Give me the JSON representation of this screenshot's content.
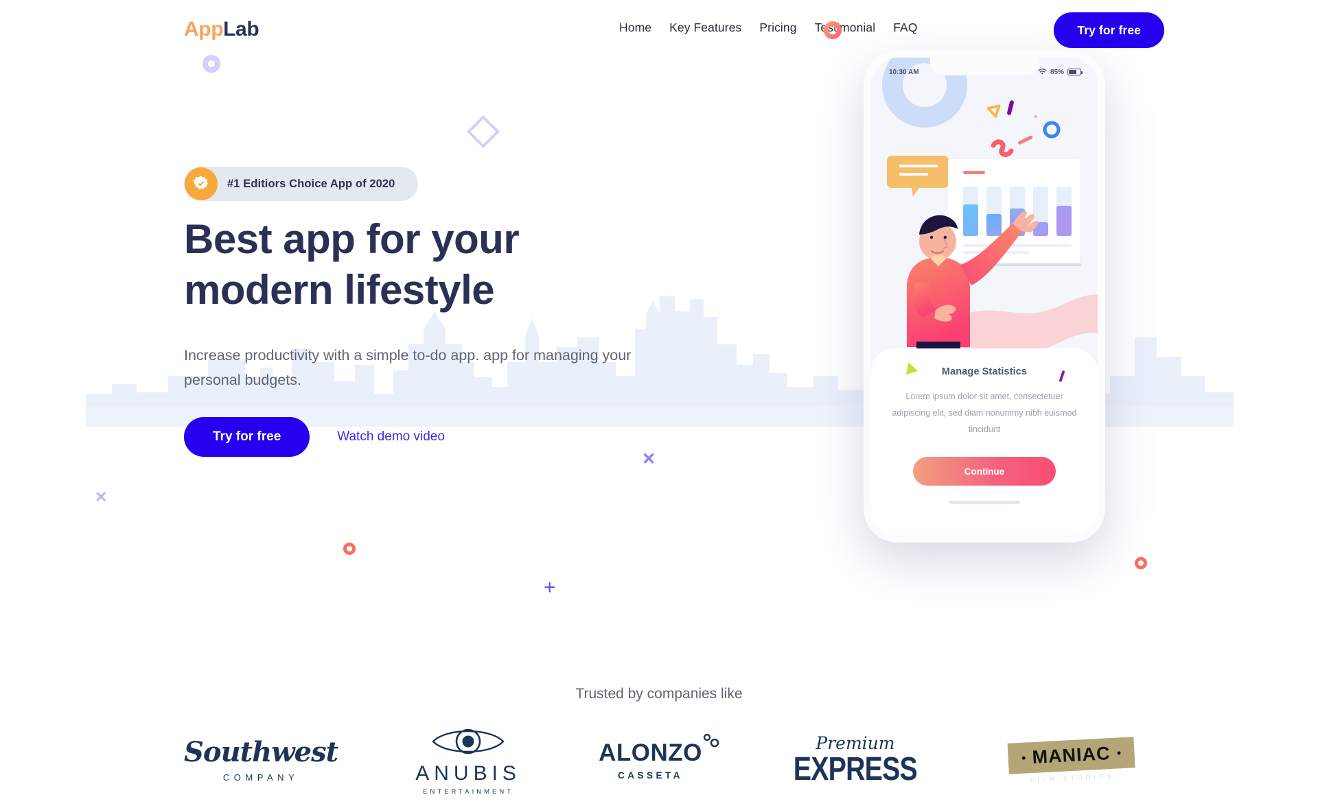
{
  "brand": {
    "name_part1": "App",
    "name_part2": "Lab",
    "color_accent": "#F6A560",
    "color_dark": "#2B3154"
  },
  "nav": {
    "items": [
      {
        "label": "Home"
      },
      {
        "label": "Key Features"
      },
      {
        "label": "Pricing"
      },
      {
        "label": "Testimonial"
      },
      {
        "label": "FAQ"
      }
    ],
    "cta_label": "Try for free",
    "cta_color": "#2400EE"
  },
  "hero": {
    "badge": {
      "text": "#1 Editiors Choice App of 2020",
      "icon": "verified-badge-icon",
      "icon_color": "#F9A83E",
      "bg": "#E4E9EF"
    },
    "headline_line1": "Best app for your",
    "headline_line2": "modern lifestyle",
    "subhead": "Increase productivity with a simple to-do app. app for managing your personal budgets.",
    "primary_cta": "Try for free",
    "secondary_cta": "Watch demo video",
    "secondary_cta_color": "#3A2BE8"
  },
  "decorations": [
    {
      "name": "ring-purple",
      "color": "#D5CFFA"
    },
    {
      "name": "diamond-outline",
      "color": "#D4CEFB"
    },
    {
      "name": "cross-mark",
      "color": "#8A7BF2"
    },
    {
      "name": "cross-mark",
      "color": "#B9B2F5"
    },
    {
      "name": "plus-sign",
      "color": "#4D5BE8"
    },
    {
      "name": "ring-coral",
      "color": "#FA6E62"
    },
    {
      "name": "ring-coral",
      "color": "#FA6E62"
    },
    {
      "name": "nav-ring-gradient",
      "color": "#FB5E6E"
    }
  ],
  "phone": {
    "status": {
      "time": "10:30 AM",
      "battery_percent": "85%",
      "wifi": "wifi-icon"
    },
    "card": {
      "title": "Manage Statistics",
      "body": "Lorem ipsum dolor sit amet, consectetuer adipiscing elit, sed diam nonummy nibh euismod tincidunt",
      "button_label": "Continue",
      "button_gradient_from": "#F0A07E",
      "button_gradient_to": "#F84D74"
    }
  },
  "trusted": {
    "label": "Trusted by companies like",
    "logos": [
      {
        "name": "Southwest",
        "sub": "COMPANY"
      },
      {
        "name": "ANUBIS",
        "sub": "ENTERTAINMENT"
      },
      {
        "name": "ALONZO",
        "sub": "CASSETA"
      },
      {
        "name": "Premium",
        "sub": "EXPRESS"
      },
      {
        "name": "MANIAC",
        "sub": "FILM STUDIOS"
      }
    ]
  }
}
